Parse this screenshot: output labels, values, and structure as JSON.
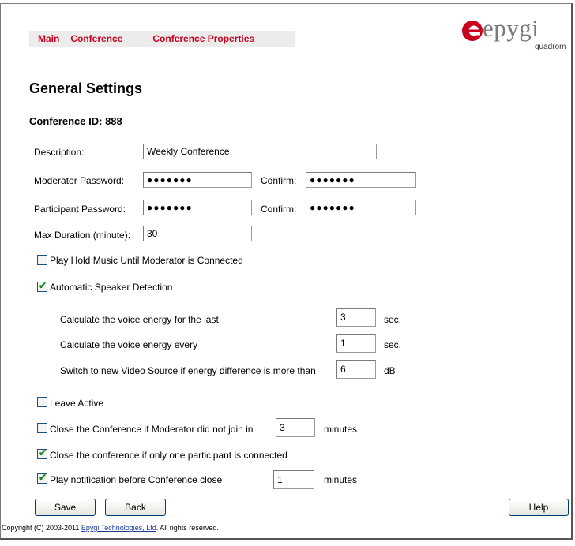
{
  "breadcrumb": {
    "main": "Main",
    "conference": "Conference",
    "properties": "Conference Properties"
  },
  "logo": {
    "word": "epygi",
    "sub": "quadrom",
    "color": "#c8001e"
  },
  "page_title": "General Settings",
  "conference_id": "Conference ID: 888",
  "form": {
    "description_label": "Description:",
    "description_value": "Weekly Conference",
    "moderator_label": "Moderator Password:",
    "moderator_value": "●●●●●●●",
    "moderator_confirm_label": "Confirm:",
    "moderator_confirm_value": "●●●●●●●",
    "participant_label": "Participant Password:",
    "participant_value": "●●●●●●●",
    "participant_confirm_label": "Confirm:",
    "participant_confirm_value": "●●●●●●●",
    "max_duration_label": "Max Duration (minute):",
    "max_duration_value": "30"
  },
  "options": {
    "hold_music": {
      "label": "Play Hold Music Until Moderator is Connected",
      "checked": false
    },
    "auto_speaker": {
      "label": "Automatic Speaker Detection",
      "checked": true
    },
    "energy_last_label": "Calculate the voice energy for the last",
    "energy_last_value": "3",
    "energy_last_unit": "sec.",
    "energy_every_label": "Calculate the voice energy every",
    "energy_every_value": "1",
    "energy_every_unit": "sec.",
    "switch_label": "Switch to new Video Source if energy difference is more than",
    "switch_value": "6",
    "switch_unit": "dB",
    "leave_active": {
      "label": "Leave Active",
      "checked": false
    },
    "close_if_no_moderator": {
      "label": "Close the Conference if Moderator did not join in",
      "checked": false,
      "value": "3",
      "unit": "minutes"
    },
    "close_if_one": {
      "label": "Close the conference if only one participant is connected",
      "checked": true
    },
    "play_notification": {
      "label": "Play notification before Conference close",
      "checked": true,
      "value": "1",
      "unit": "minutes"
    }
  },
  "buttons": {
    "save": "Save",
    "back": "Back",
    "help": "Help"
  },
  "footer": {
    "prefix": "Copyright (C) 2003-2011 ",
    "link": "Epygi Technologies, Ltd",
    "suffix": ". All rights reserved."
  }
}
